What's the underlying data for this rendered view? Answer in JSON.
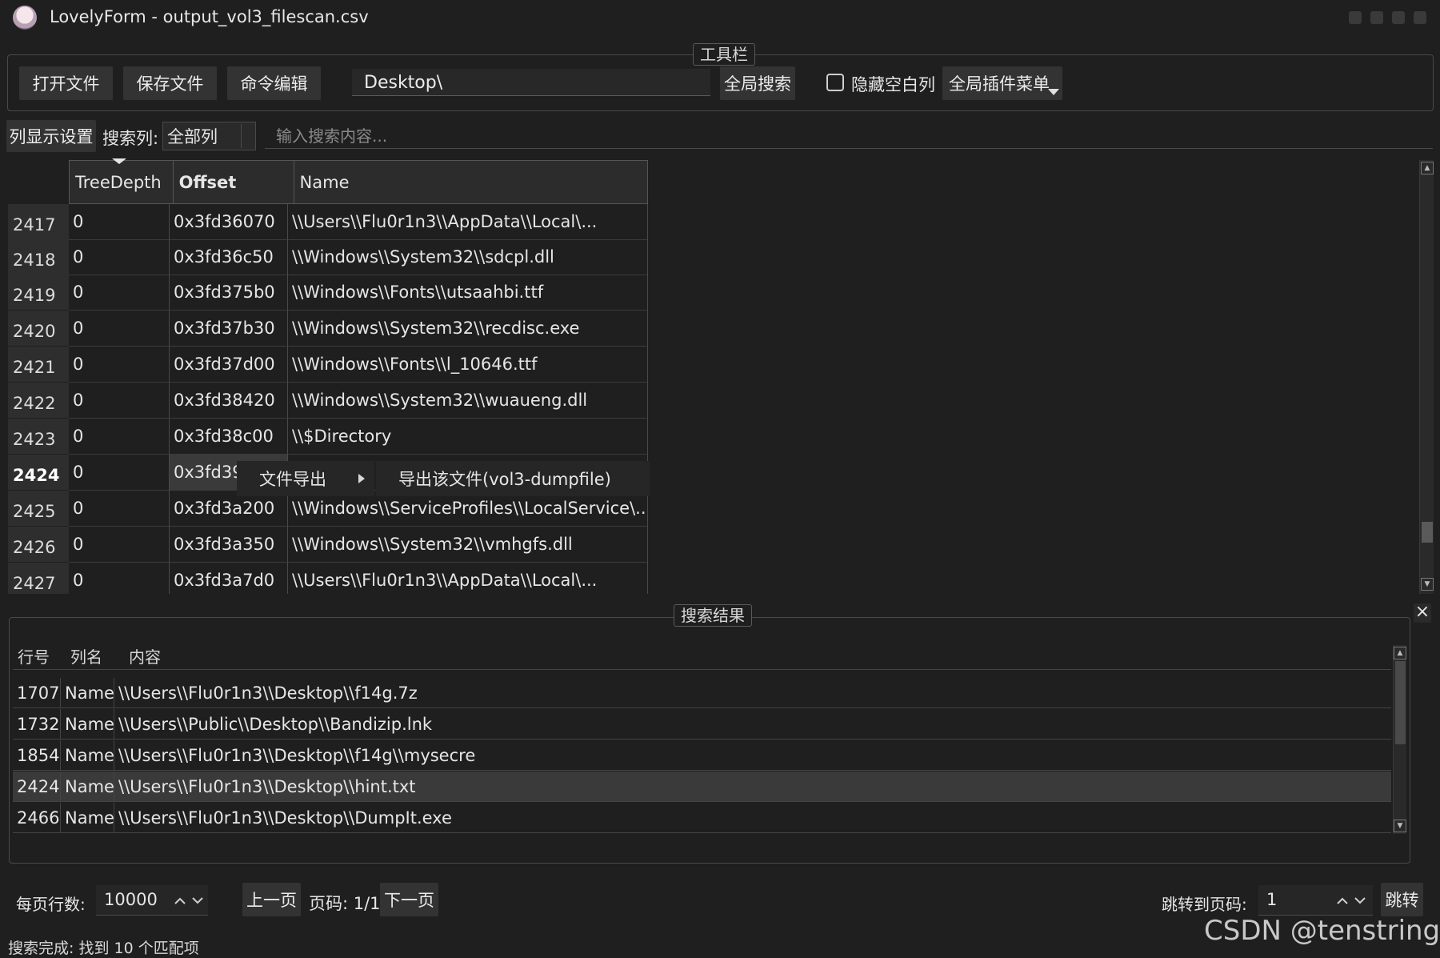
{
  "window": {
    "app_name": "LovelyForm",
    "separator": "-",
    "file_name": "output_vol3_filescan.csv"
  },
  "toolbar": {
    "group_label": "工具栏",
    "open_label": "打开文件",
    "save_label": "保存文件",
    "cmd_label": "命令编辑",
    "path_value": "Desktop\\",
    "global_search_label": "全局搜索",
    "hide_empty_label": "隐藏空白列",
    "plugin_menu_label": "全局插件菜单"
  },
  "filter": {
    "column_settings_label": "列显示设置",
    "search_col_label": "搜索列:",
    "search_col_value": "全部列",
    "search_placeholder": "输入搜索内容..."
  },
  "table": {
    "columns": [
      "TreeDepth",
      "Offset",
      "Name"
    ],
    "rows": [
      {
        "row": "2417",
        "depth": "0",
        "offset": "0x3fd36070",
        "name": "\\\\Users\\\\Flu0r1n3\\\\AppData\\\\Local\\..."
      },
      {
        "row": "2418",
        "depth": "0",
        "offset": "0x3fd36c50",
        "name": "\\\\Windows\\\\System32\\\\sdcpl.dll"
      },
      {
        "row": "2419",
        "depth": "0",
        "offset": "0x3fd375b0",
        "name": "\\\\Windows\\\\Fonts\\\\utsaahbi.ttf"
      },
      {
        "row": "2420",
        "depth": "0",
        "offset": "0x3fd37b30",
        "name": "\\\\Windows\\\\System32\\\\recdisc.exe"
      },
      {
        "row": "2421",
        "depth": "0",
        "offset": "0x3fd37d00",
        "name": "\\\\Windows\\\\Fonts\\\\l_10646.ttf"
      },
      {
        "row": "2422",
        "depth": "0",
        "offset": "0x3fd38420",
        "name": "\\\\Windows\\\\System32\\\\wuaueng.dll"
      },
      {
        "row": "2423",
        "depth": "0",
        "offset": "0x3fd38c00",
        "name": "\\\\$Directory"
      },
      {
        "row": "2424",
        "depth": "0",
        "offset": "0x3fd39(",
        "name": ""
      },
      {
        "row": "2425",
        "depth": "0",
        "offset": "0x3fd3a200",
        "name": "\\\\Windows\\\\ServiceProfiles\\\\LocalService\\..."
      },
      {
        "row": "2426",
        "depth": "0",
        "offset": "0x3fd3a350",
        "name": "\\\\Windows\\\\System32\\\\vmhgfs.dll"
      },
      {
        "row": "2427",
        "depth": "0",
        "offset": "0x3fd3a7d0",
        "name": "\\\\Users\\\\Flu0r1n3\\\\AppData\\\\Local\\..."
      }
    ]
  },
  "context_menu": {
    "item_label": "文件导出",
    "submenu_label": "导出该文件(vol3-dumpfile)"
  },
  "search_results": {
    "group_label": "搜索结果",
    "close_glyph": "×",
    "headers": [
      "行号",
      "列名",
      "内容"
    ],
    "rows": [
      {
        "line": "1707",
        "column": "Name",
        "content": "\\\\Users\\\\Flu0r1n3\\\\Desktop\\\\f14g.7z"
      },
      {
        "line": "1732",
        "column": "Name",
        "content": "\\\\Users\\\\Public\\\\Desktop\\\\Bandizip.lnk"
      },
      {
        "line": "1854",
        "column": "Name",
        "content": "\\\\Users\\\\Flu0r1n3\\\\Desktop\\\\f14g\\\\mysecre"
      },
      {
        "line": "2424",
        "column": "Name",
        "content": "\\\\Users\\\\Flu0r1n3\\\\Desktop\\\\hint.txt"
      },
      {
        "line": "2466",
        "column": "Name",
        "content": "\\\\Users\\\\Flu0r1n3\\\\Desktop\\\\DumpIt.exe"
      }
    ]
  },
  "pager": {
    "rows_per_page_label": "每页行数:",
    "rows_per_page_value": "10000",
    "prev_label": "上一页",
    "page_info": "页码: 1/1",
    "next_label": "下一页",
    "goto_label": "跳转到页码:",
    "goto_value": "1",
    "jump_label": "跳转"
  },
  "status": {
    "text": "搜索完成: 找到 10 个匹配项"
  },
  "watermark": "CSDN @tenstrings",
  "colors": {
    "background": "#1f1f1f",
    "panel": "#333333",
    "text": "#e6e6e6",
    "border": "#4a4a4a"
  },
  "icons": [
    "app-avatar-icon",
    "dropdown-arrow-icon",
    "submenu-arrow-icon",
    "close-icon",
    "spin-up-icon",
    "spin-down-icon"
  ]
}
